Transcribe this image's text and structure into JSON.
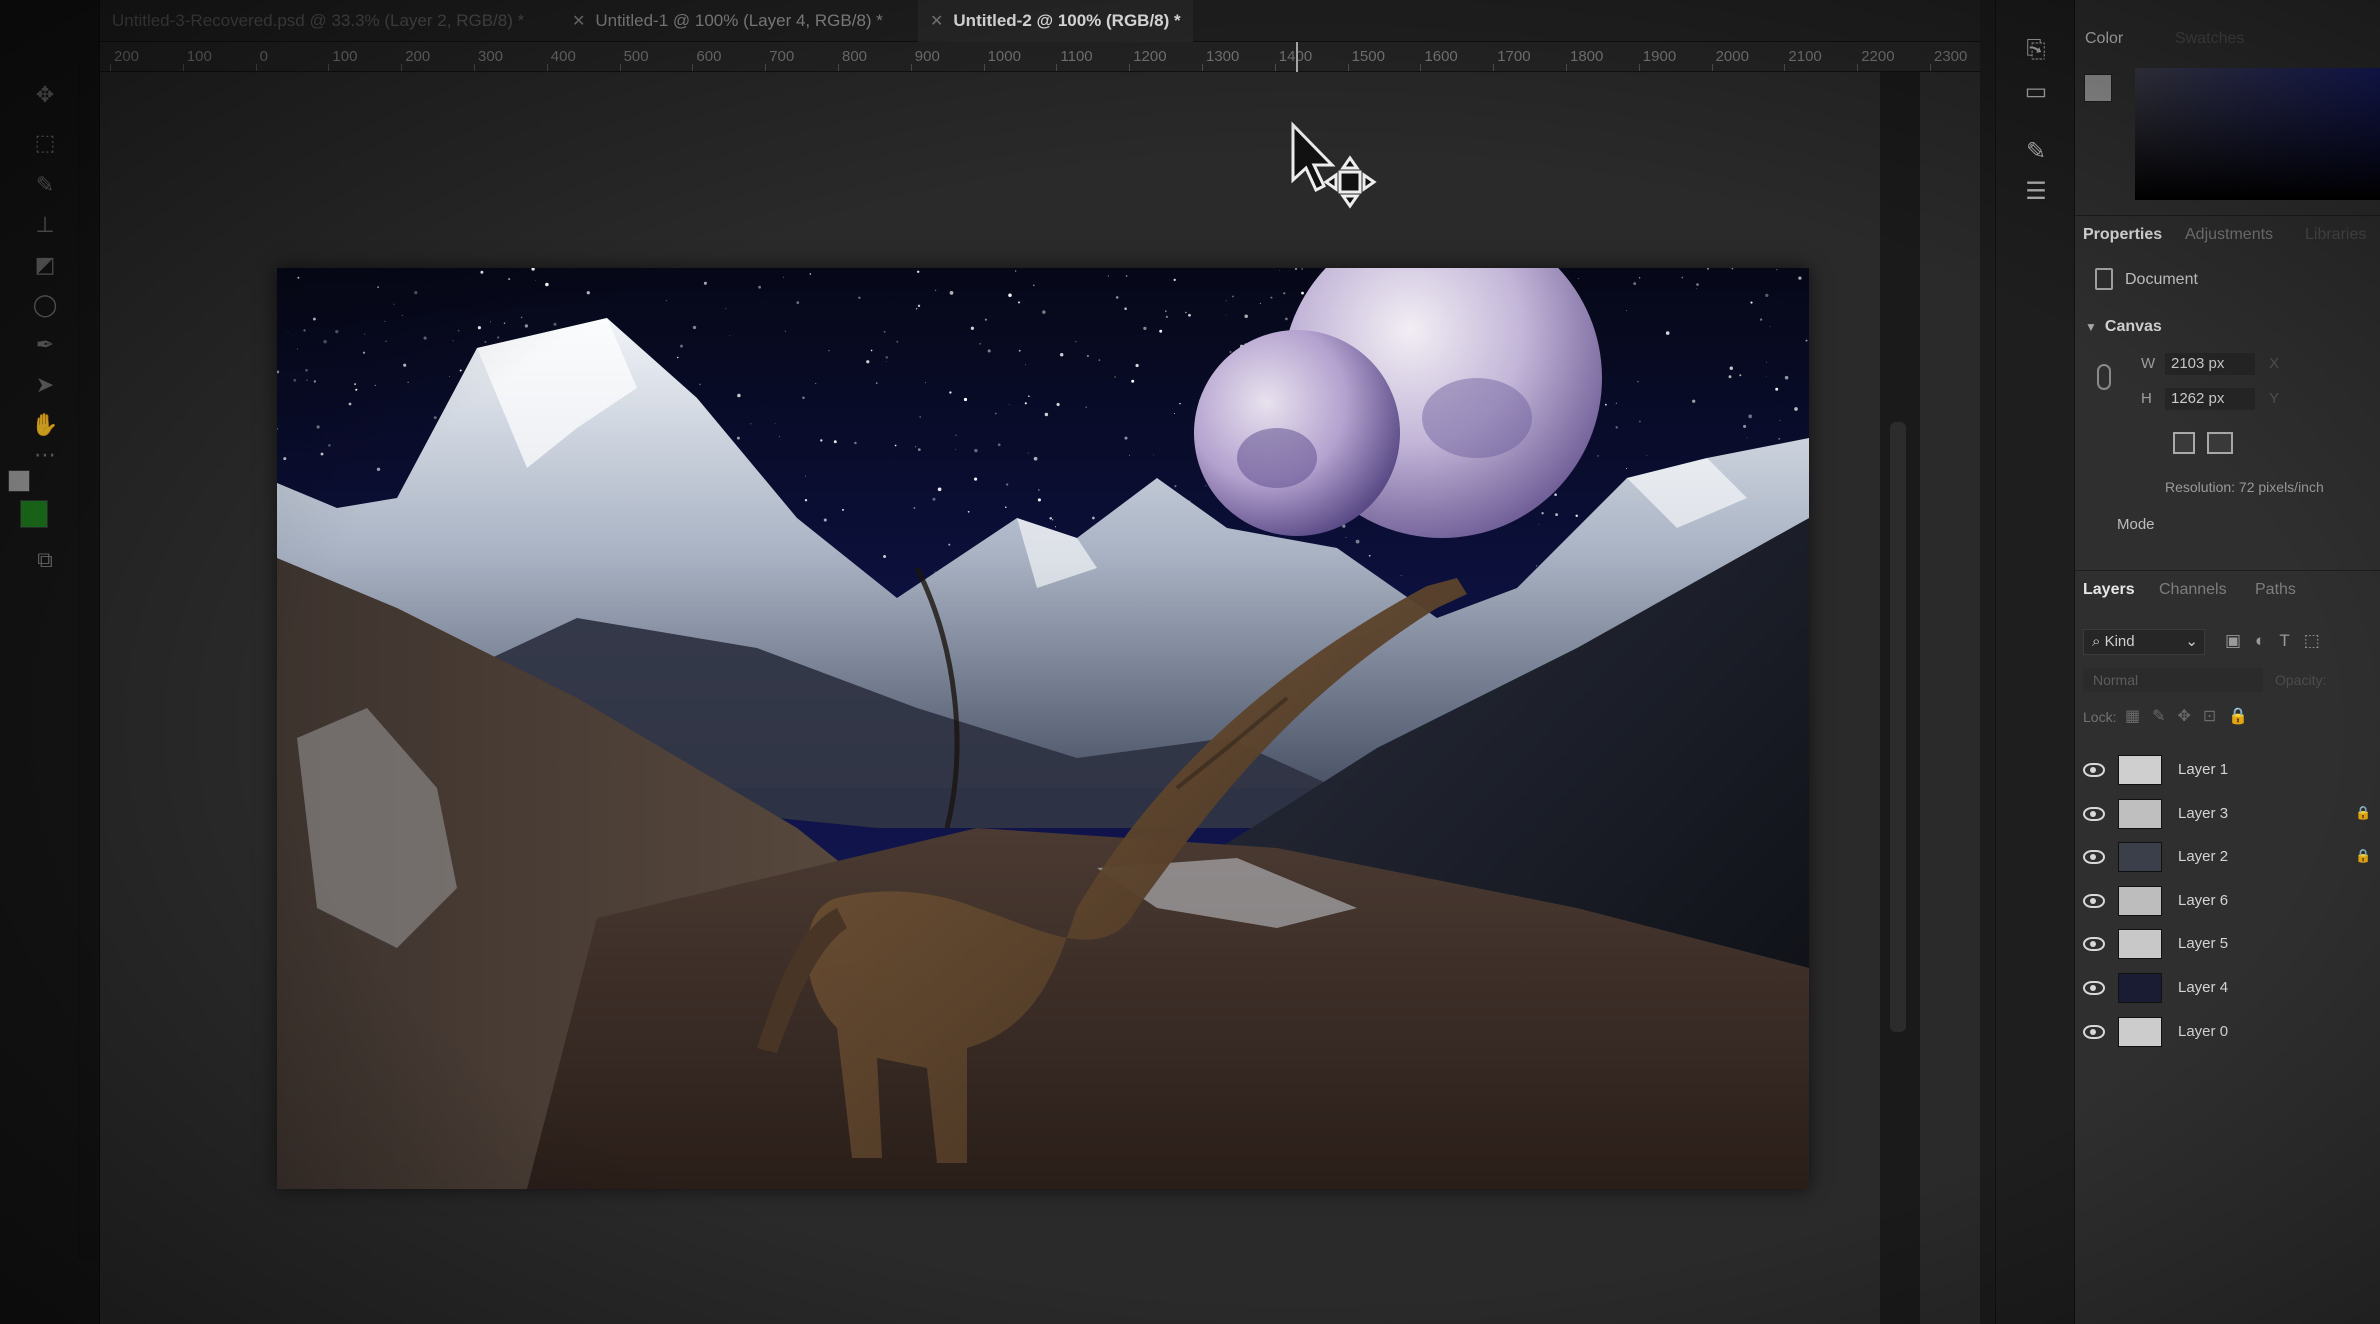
{
  "tabs": [
    {
      "label": "Untitled-3-Recovered.psd @ 33.3% (Layer 2, RGB/8) *",
      "active": false
    },
    {
      "label": "Untitled-1 @ 100% (Layer 4, RGB/8) *",
      "active": false
    },
    {
      "label": "Untitled-2 @ 100% (RGB/8) *",
      "active": true
    }
  ],
  "ruler": {
    "ticks": [
      "200",
      "100",
      "0",
      "100",
      "200",
      "300",
      "400",
      "500",
      "600",
      "700",
      "800",
      "900",
      "1000",
      "1100",
      "1200",
      "1300",
      "1400",
      "1500",
      "1600",
      "1700",
      "1800",
      "1900",
      "2000",
      "2100",
      "2200",
      "2300"
    ]
  },
  "panels": {
    "color": {
      "tabs": [
        "Color",
        "Swatches"
      ]
    },
    "properties": {
      "tabs": [
        "Properties",
        "Adjustments",
        "Libraries"
      ],
      "document_label": "Document",
      "canvas_section": "Canvas",
      "width_label": "W",
      "width_value": "2103 px",
      "x_label": "X",
      "height_label": "H",
      "height_value": "1262 px",
      "y_label": "Y",
      "resolution": "Resolution: 72 pixels/inch",
      "mode_label": "Mode"
    },
    "layers": {
      "tabs": [
        "Layers",
        "Channels",
        "Paths"
      ],
      "filter_label": "Kind",
      "blend_mode": "Normal",
      "opacity_label": "Opacity:",
      "lock_label": "Lock:",
      "items": [
        {
          "name": "Layer 1",
          "locked": false
        },
        {
          "name": "Layer 3",
          "locked": true
        },
        {
          "name": "Layer 2",
          "locked": true
        },
        {
          "name": "Layer 6",
          "locked": false
        },
        {
          "name": "Layer 5",
          "locked": false
        },
        {
          "name": "Layer 4",
          "locked": false
        },
        {
          "name": "Layer 0",
          "locked": false
        }
      ]
    }
  },
  "colors": {
    "foreground": "#9c9c9c",
    "background": "#1e7a1e",
    "sky": "#0b0d33",
    "planet": "#b9a8d6"
  },
  "icons": {
    "cursor": "move-cursor-icon",
    "eye": "eye-icon",
    "lock": "lock-icon"
  }
}
